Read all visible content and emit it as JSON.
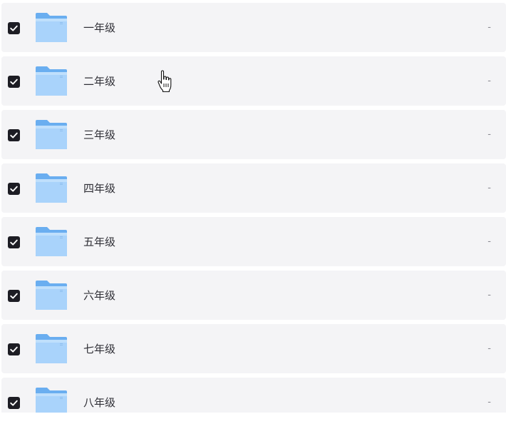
{
  "items": [
    {
      "label": "一年级",
      "size": "-",
      "checked": true
    },
    {
      "label": "二年级",
      "size": "-",
      "checked": true
    },
    {
      "label": "三年级",
      "size": "-",
      "checked": true
    },
    {
      "label": "四年级",
      "size": "-",
      "checked": true
    },
    {
      "label": "五年级",
      "size": "-",
      "checked": true
    },
    {
      "label": "六年级",
      "size": "-",
      "checked": true
    },
    {
      "label": "七年级",
      "size": "-",
      "checked": true
    },
    {
      "label": "八年级",
      "size": "-",
      "checked": true
    }
  ],
  "icons": {
    "checkbox": "check-icon",
    "item": "folder-icon",
    "cursor": "hand-pointer-icon"
  },
  "colors": {
    "row_bg": "#f4f4f6",
    "checkbox_bg": "#1d1d24",
    "folder_light": "#a9d3fb",
    "folder_dark": "#6aaef0"
  }
}
